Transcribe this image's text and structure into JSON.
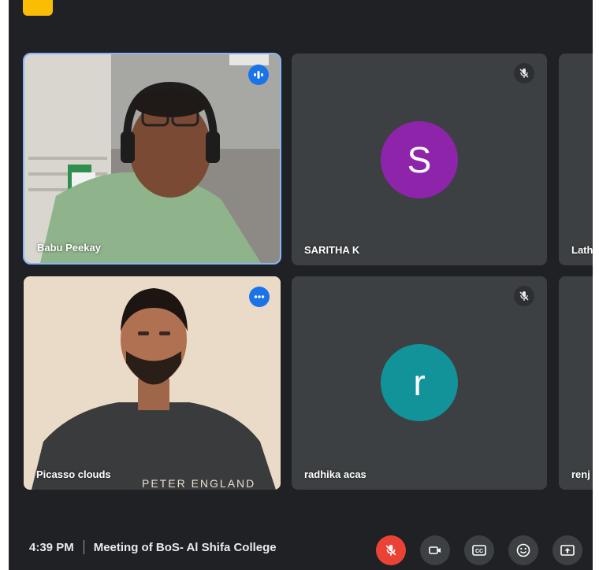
{
  "participants": [
    {
      "name": "Babu Peekay",
      "state": "speaking",
      "video": true
    },
    {
      "name": "SARITHA K",
      "state": "muted",
      "initial": "S",
      "avatar_color": "#8e24aa"
    },
    {
      "name": "Lath",
      "state": "unknown"
    },
    {
      "name": "Picasso clouds",
      "state": "speaking",
      "video": true
    },
    {
      "name": "radhika acas",
      "state": "muted",
      "initial": "r",
      "avatar_color": "#12939a"
    },
    {
      "name": "renj",
      "state": "unknown"
    }
  ],
  "shirt_text": "PETER ENGLAND",
  "bottom_bar": {
    "time": "4:39 PM",
    "meeting_title": "Meeting of BoS- Al Shifa College"
  },
  "controls": [
    {
      "name": "mic-off-button",
      "icon": "mic-off-icon",
      "color": "#ea4335"
    },
    {
      "name": "camera-button",
      "icon": "video-camera-icon"
    },
    {
      "name": "captions-button",
      "icon": "closed-captions-icon"
    },
    {
      "name": "reactions-button",
      "icon": "smiley-icon"
    },
    {
      "name": "present-button",
      "icon": "present-screen-icon"
    }
  ],
  "colors": {
    "background": "#202124",
    "tile": "#3c4043",
    "active_border": "#8ab4f8",
    "speaking_badge": "#1a73e8"
  }
}
